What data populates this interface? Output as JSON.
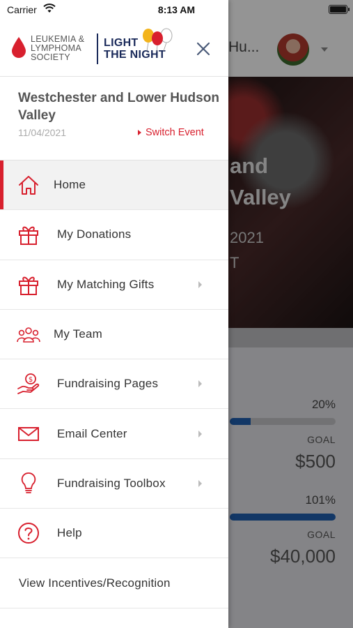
{
  "status_bar": {
    "carrier": "Carrier",
    "time": "8:13 AM"
  },
  "background": {
    "header_title": "Hu...",
    "hero_line1": "and",
    "hero_line2": "Valley",
    "hero_date": "2021",
    "hero_sub": "T",
    "progress1": {
      "percent_label": "20%",
      "fill": 0.2,
      "goal_label": "GOAL",
      "goal_value": "$500"
    },
    "progress2": {
      "percent_label": "101%",
      "fill": 1.0,
      "goal_label": "GOAL",
      "goal_value": "$40,000"
    }
  },
  "drawer": {
    "logo": {
      "lls_line1": "LEUKEMIA &",
      "lls_line2": "LYMPHOMA",
      "lls_line3": "SOCIETY",
      "ltn_line1": "LIGHT",
      "ltn_line2": "THE NIGHT"
    },
    "event": {
      "name": "Westchester and Lower Hudson Valley",
      "date": "11/04/2021",
      "switch_label": "Switch Event"
    },
    "menu": [
      {
        "label": "Home",
        "icon": "home-icon",
        "active": true,
        "chevron": false
      },
      {
        "label": "My Donations",
        "icon": "gift-icon",
        "active": false,
        "chevron": false
      },
      {
        "label": "My Matching Gifts",
        "icon": "gift-icon",
        "active": false,
        "chevron": true
      },
      {
        "label": "My Team",
        "icon": "team-icon",
        "active": false,
        "chevron": false
      },
      {
        "label": "Fundraising Pages",
        "icon": "money-hand-icon",
        "active": false,
        "chevron": true
      },
      {
        "label": "Email Center",
        "icon": "envelope-icon",
        "active": false,
        "chevron": true
      },
      {
        "label": "Fundraising Toolbox",
        "icon": "lightbulb-icon",
        "active": false,
        "chevron": true
      },
      {
        "label": "Help",
        "icon": "help-icon",
        "active": false,
        "chevron": false
      },
      {
        "label": "View Incentives/Recognition",
        "icon": "",
        "active": false,
        "chevron": false
      }
    ]
  },
  "colors": {
    "accent": "#d8202e",
    "navy": "#1a2a5a",
    "progress_blue": "#1f5fb0"
  }
}
